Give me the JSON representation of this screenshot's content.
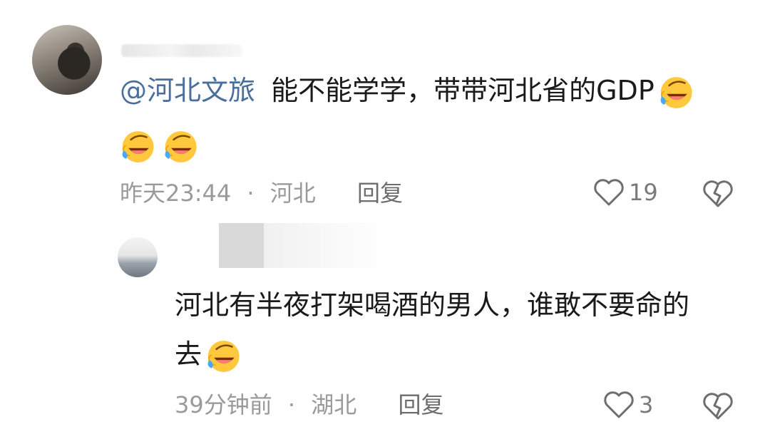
{
  "comments": [
    {
      "mention": "@河北文旅",
      "text": "能不能学学，带带河北省的GDP",
      "emoji_name": "laughing-crying-emoji",
      "time": "昨天23:44",
      "sep": "·",
      "location": "河北",
      "reply_label": "回复",
      "likes": "19"
    },
    {
      "text_line1": "河北有半夜打架喝酒的男人，谁敢不要命的",
      "text_line2": "去",
      "emoji_name": "laughing-crying-emoji",
      "time": "39分钟前",
      "sep": "·",
      "location": "湖北",
      "reply_label": "回复",
      "likes": "3"
    }
  ],
  "colors": {
    "mention": "#4a6f9c",
    "meta": "#9a9a9a",
    "text": "#1a1a1a"
  },
  "icons": [
    "heart-outline-icon",
    "broken-heart-icon"
  ]
}
